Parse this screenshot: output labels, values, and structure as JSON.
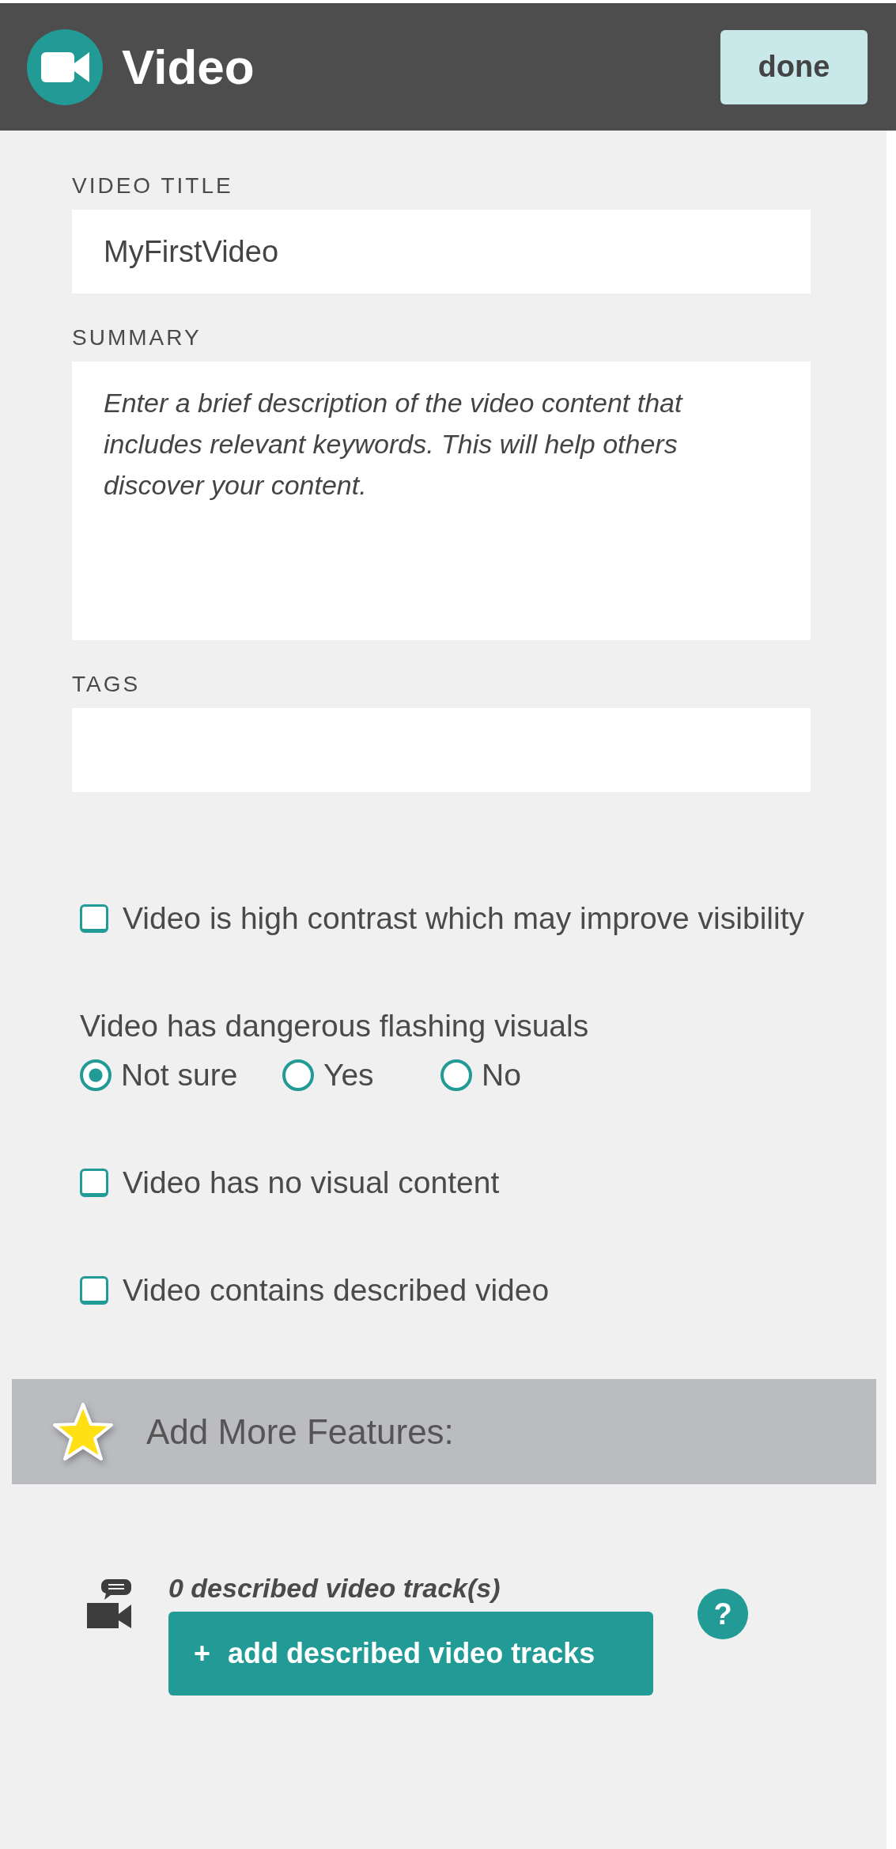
{
  "header": {
    "title": "Video",
    "done_button": "done"
  },
  "fields": [
    {
      "label": "VIDEO TITLE",
      "kind": "input",
      "value": "MyFirstVideo"
    },
    {
      "label": "SUMMARY",
      "kind": "textarea",
      "placeholder": "Enter a brief description of the video content that includes relevant keywords. This will help others discover your content."
    },
    {
      "label": "TAGS",
      "kind": "input"
    }
  ],
  "options": [
    {
      "kind": "checkbox",
      "label": "Video is high contrast which may improve visibility",
      "checked": false
    },
    {
      "kind": "radio_group",
      "question": "Video has dangerous flashing visuals",
      "choices": [
        {
          "label": "Not sure",
          "selected": true
        },
        {
          "label": "Yes",
          "selected": false
        },
        {
          "label": "No",
          "selected": false
        }
      ]
    },
    {
      "kind": "checkbox",
      "label": "Video has no visual content",
      "checked": false
    },
    {
      "kind": "checkbox",
      "label": "Video contains described video",
      "checked": false
    }
  ],
  "features": {
    "title": "Add More Features:",
    "track_count": "0 described video track(s)",
    "add_button": {
      "icon": "+",
      "label": "add described video tracks"
    },
    "help": "?"
  }
}
